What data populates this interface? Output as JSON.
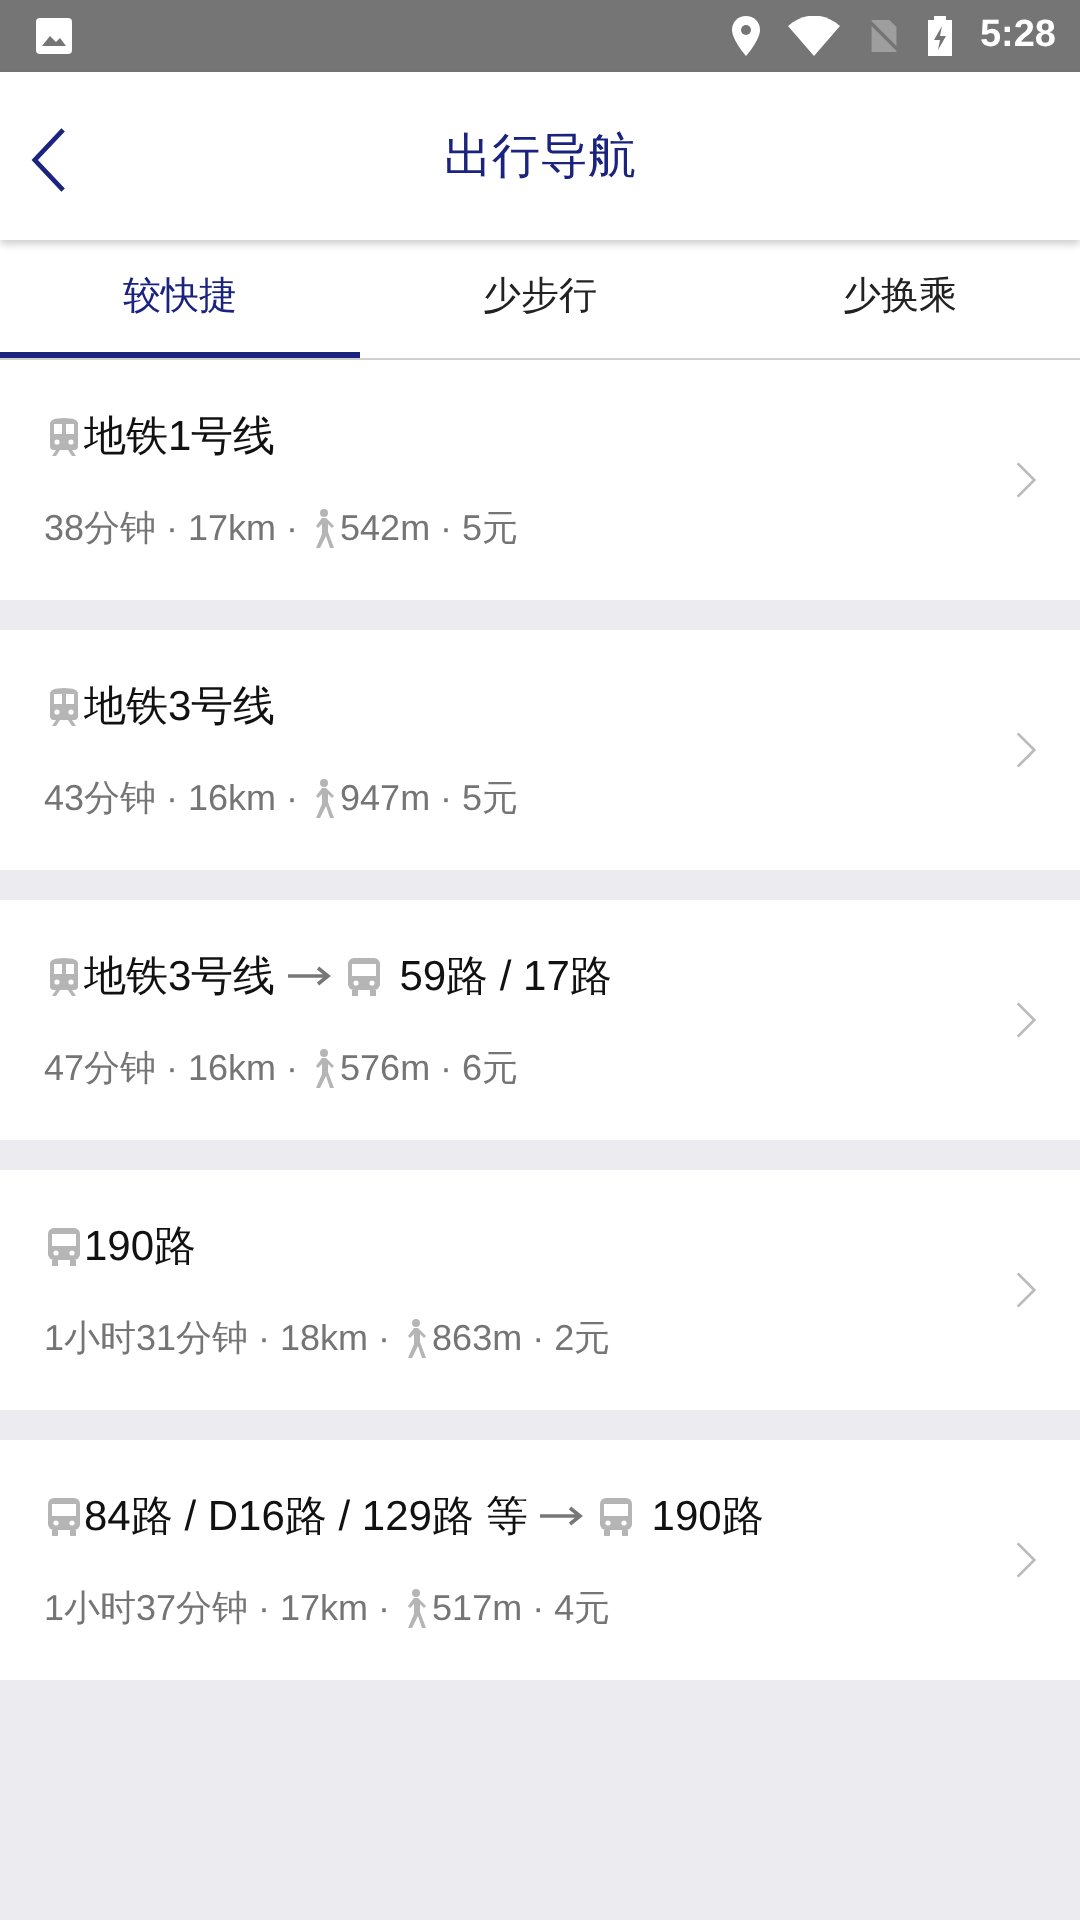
{
  "status_bar": {
    "time": "5:28"
  },
  "header": {
    "title": "出行导航"
  },
  "tabs": [
    {
      "label": "较快捷",
      "selected": true
    },
    {
      "label": "少步行",
      "selected": false
    },
    {
      "label": "少换乘",
      "selected": false
    }
  ],
  "routes": [
    {
      "segments": [
        {
          "kind": "subway",
          "name": "地铁1号线"
        }
      ],
      "summary": "38分钟 · 17km · ",
      "walk": "542m · 5元"
    },
    {
      "segments": [
        {
          "kind": "subway",
          "name": "地铁3号线"
        }
      ],
      "summary": "43分钟 · 16km · ",
      "walk": "947m · 5元"
    },
    {
      "segments": [
        {
          "kind": "subway",
          "name": "地铁3号线"
        },
        {
          "kind": "bus",
          "name": "59路 / 17路"
        }
      ],
      "summary": "47分钟 · 16km · ",
      "walk": "576m · 6元"
    },
    {
      "segments": [
        {
          "kind": "bus",
          "name": "190路"
        }
      ],
      "summary": "1小时31分钟 · 18km · ",
      "walk": "863m · 2元"
    },
    {
      "segments": [
        {
          "kind": "bus",
          "name": "84路 / D16路 / 129路 等"
        },
        {
          "kind": "bus",
          "name": "190路"
        }
      ],
      "summary": "1小时37分钟 · 17km · ",
      "walk": "517m · 4元"
    }
  ]
}
